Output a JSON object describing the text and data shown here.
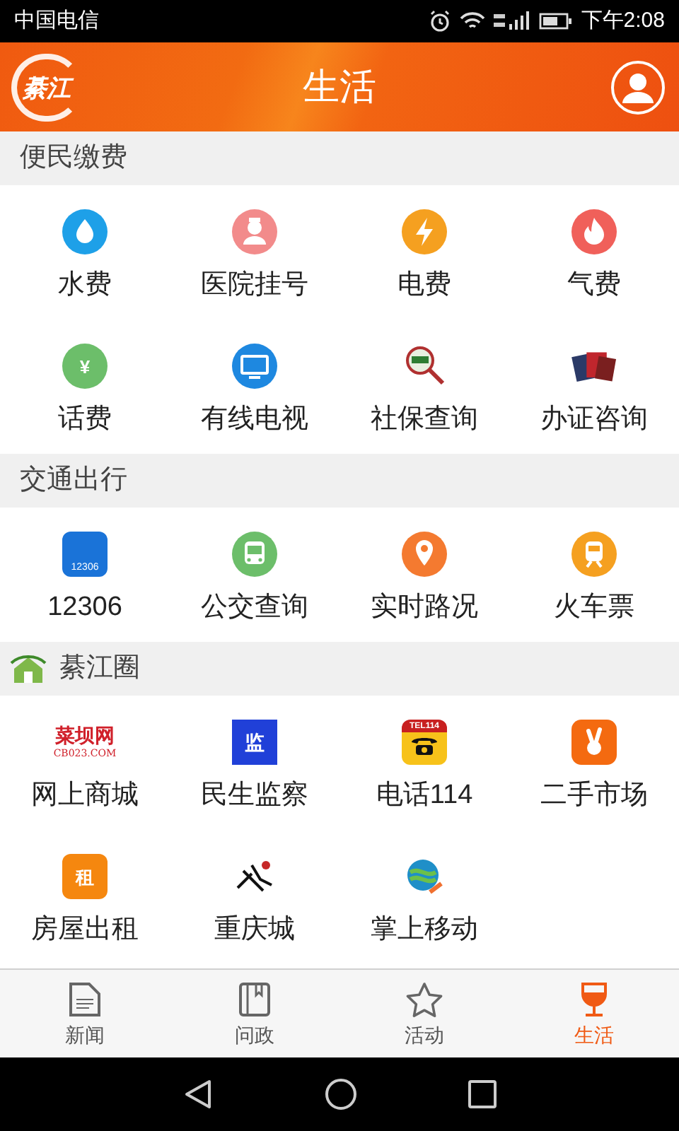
{
  "status_bar": {
    "carrier": "中国电信",
    "time": "下午2:08"
  },
  "header": {
    "logo_text": "綦江",
    "title": "生活"
  },
  "sections": [
    {
      "title": "便民缴费",
      "items": [
        {
          "label": "水费"
        },
        {
          "label": "医院挂号"
        },
        {
          "label": "电费"
        },
        {
          "label": "气费"
        },
        {
          "label": "话费",
          "icon_text": "¥"
        },
        {
          "label": "有线电视"
        },
        {
          "label": "社保查询"
        },
        {
          "label": "办证咨询"
        }
      ]
    },
    {
      "title": "交通出行",
      "items": [
        {
          "label": "12306",
          "icon_text": "12306"
        },
        {
          "label": "公交查询"
        },
        {
          "label": "实时路况"
        },
        {
          "label": "火车票"
        }
      ]
    },
    {
      "title": "綦江圈",
      "has_logo": true,
      "items": [
        {
          "label": "网上商城",
          "icon_text": "菜坝网",
          "icon_subtext": "CB023.COM"
        },
        {
          "label": "民生监察",
          "icon_text": "监"
        },
        {
          "label": "电话114",
          "icon_text": "TEL114"
        },
        {
          "label": "二手市场"
        },
        {
          "label": "房屋出租",
          "icon_text": "租"
        },
        {
          "label": "重庆城"
        },
        {
          "label": "掌上移动"
        }
      ]
    }
  ],
  "tabs": [
    {
      "label": "新闻",
      "selected": false
    },
    {
      "label": "问政",
      "selected": false
    },
    {
      "label": "活动",
      "selected": false
    },
    {
      "label": "生活",
      "selected": true
    }
  ]
}
